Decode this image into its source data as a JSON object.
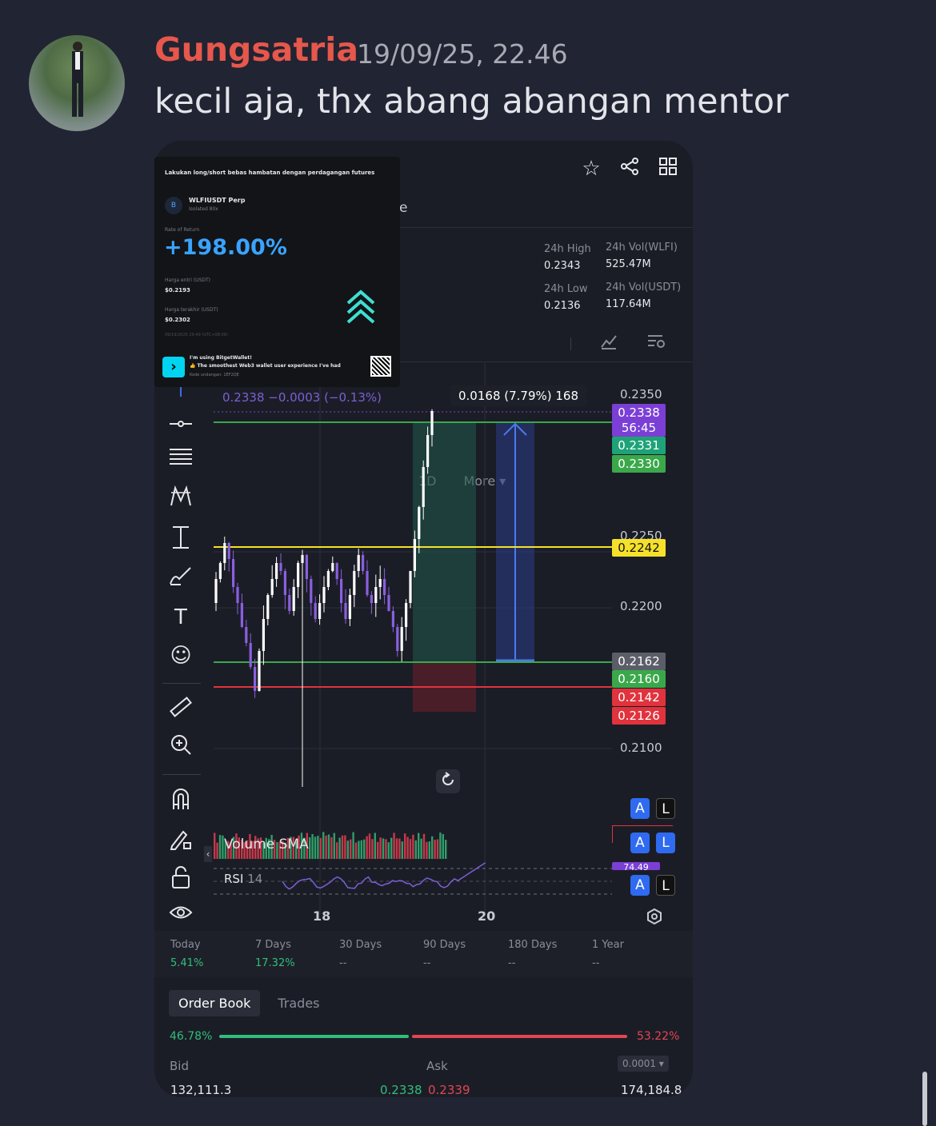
{
  "message": {
    "author": "Gungsatria",
    "timestamp": "19/09/25, 22.46",
    "text": "kecil aja, thx abang abangan mentor"
  },
  "popup": {
    "headline": "Lakukan long/short bebas hambatan dengan perdagangan futures",
    "pair": "WLFIUSDT Perp",
    "mode": "Isolated 80x",
    "coin_letter": "B",
    "ror_label": "Rate of Return",
    "ror_value": "+198.00%",
    "entry_label": "Harga entri (USDT)",
    "entry_value": "$0.2193",
    "last_label": "Harga terakhir (USDT)",
    "last_value": "$0.2302",
    "date": "09/19/2025 20:49 (UTC+08:00)",
    "promo_title": "I'm using BitgetWallet!",
    "promo_text": "👍 The smoothest Web3 wallet user experience I've had",
    "invite": "Kode undangan: 1EF2QE"
  },
  "header": {
    "partial_char": "e",
    "icons": [
      "star-icon",
      "share-icon",
      "grid-icon"
    ]
  },
  "stats": {
    "high_label": "24h High",
    "high_value": "0.2343",
    "low_label": "24h Low",
    "low_value": "0.2136",
    "vol_wlfi_label": "24h Vol(WLFI)",
    "vol_wlfi_value": "525.47M",
    "vol_usdt_label": "24h Vol(USDT)",
    "vol_usdt_value": "117.64M"
  },
  "timeframe": {
    "current": "1D",
    "more": "More ▾"
  },
  "chart": {
    "ohlc_text": "0.2338  −0.0003 (−0.13%)",
    "measure_text": "0.0168 (7.79%) 168",
    "axis_labels": [
      "0.2350",
      "0.2250",
      "0.2200",
      "0.2100"
    ],
    "tags": [
      {
        "text": "0.2338",
        "color": "#7b3fd6"
      },
      {
        "text": "56:45",
        "color": "#7b3fd6"
      },
      {
        "text": "0.2331",
        "color": "#1fa278"
      },
      {
        "text": "0.2330",
        "color": "#3aa84a"
      },
      {
        "text": "0.2242",
        "color": "#f5e12a"
      },
      {
        "text": "0.2162",
        "color": "#5b5e69"
      },
      {
        "text": "0.2160",
        "color": "#3aa84a"
      },
      {
        "text": "0.2142",
        "color": "#e0333d"
      },
      {
        "text": "0.2126",
        "color": "#e0333d"
      }
    ],
    "volume_label": "Volume SMA",
    "rsi_label": "RSI",
    "rsi_period": "14",
    "rsi_tag": "74.49",
    "x_labels": [
      "18",
      "20"
    ],
    "al_a": "A",
    "al_l": "L"
  },
  "periods": [
    {
      "label": "Today",
      "value": "5.41%"
    },
    {
      "label": "7 Days",
      "value": "17.32%"
    },
    {
      "label": "30 Days",
      "value": "--"
    },
    {
      "label": "90 Days",
      "value": "--"
    },
    {
      "label": "180 Days",
      "value": "--"
    },
    {
      "label": "1 Year",
      "value": "--"
    }
  ],
  "orderbook": {
    "tabs": [
      "Order Book",
      "Trades"
    ],
    "bid_pct": "46.78%",
    "ask_pct": "53.22%",
    "bid_fraction": 0.4678,
    "bid_label": "Bid",
    "ask_label": "Ask",
    "precision": "0.0001 ▾",
    "bid_qty": "132,111.3",
    "bid_price": "0.2338",
    "ask_price": "0.2339",
    "ask_qty": "174,184.8"
  },
  "colors": {
    "up": "#2fbf7a",
    "down": "#e34653",
    "accent": "#7b3fd6"
  }
}
